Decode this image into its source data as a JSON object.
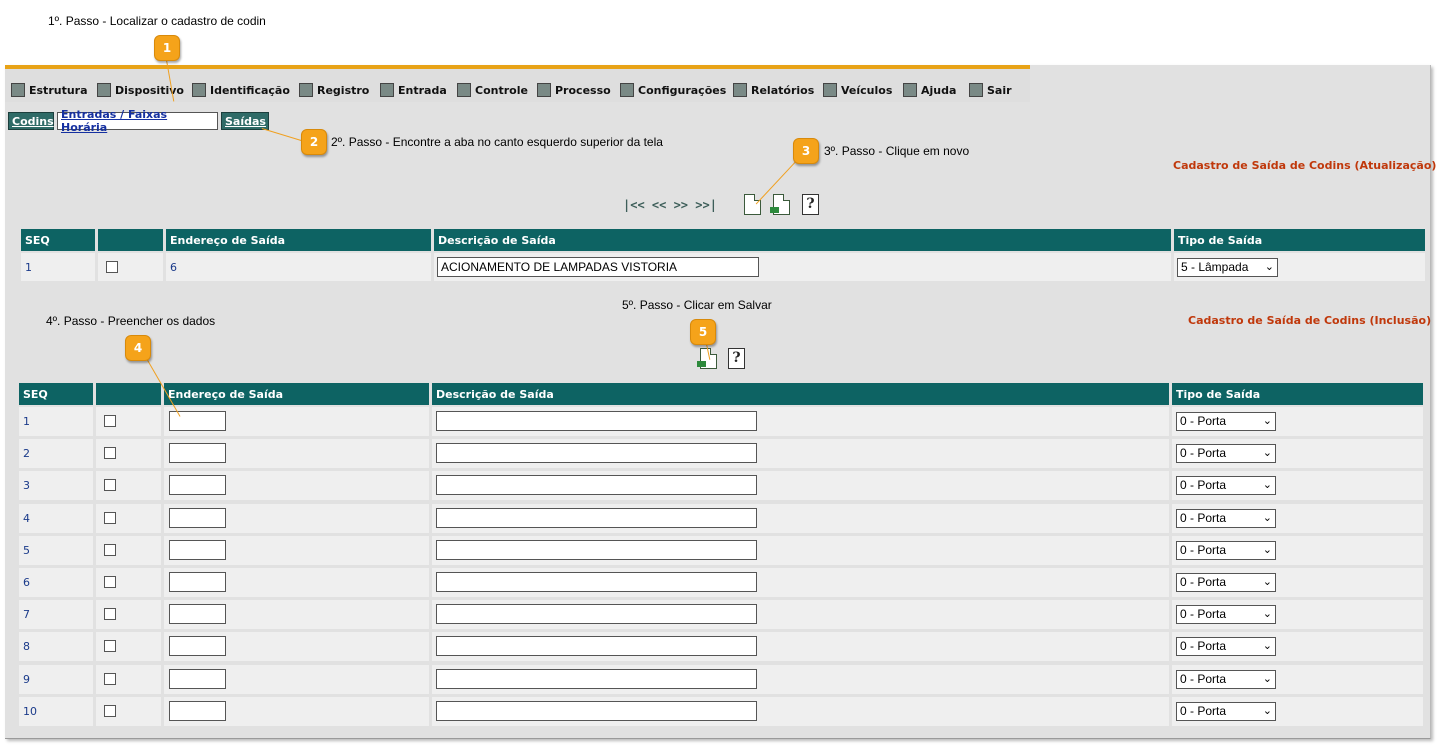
{
  "steps": {
    "s1": "1º. Passo - Localizar o cadastro de codin",
    "s2": "2º. Passo - Encontre a aba no canto esquerdo superior da tela",
    "s3": "3º. Passo - Clique em novo",
    "s4": "4º. Passo - Preencher os dados",
    "s5": "5º. Passo - Clicar em Salvar"
  },
  "badges": [
    "1",
    "2",
    "3",
    "4",
    "5"
  ],
  "menu": [
    {
      "label": "Estrutura",
      "icon": "structure-icon"
    },
    {
      "label": "Dispositivo",
      "icon": "device-icon"
    },
    {
      "label": "Identificação",
      "icon": "id-card-icon"
    },
    {
      "label": "Registro",
      "icon": "register-icon"
    },
    {
      "label": "Entrada",
      "icon": "entry-icon"
    },
    {
      "label": "Controle",
      "icon": "control-icon"
    },
    {
      "label": "Processo",
      "icon": "process-icon"
    },
    {
      "label": "Configurações",
      "icon": "settings-icon"
    },
    {
      "label": "Relatórios",
      "icon": "reports-icon"
    },
    {
      "label": "Veículos",
      "icon": "vehicle-icon"
    },
    {
      "label": "Ajuda",
      "icon": "help-icon"
    },
    {
      "label": "Sair",
      "icon": "exit-icon"
    }
  ],
  "tabs": [
    "Codins",
    "Entradas / Faixas Horária",
    "Saídas"
  ],
  "update_section": {
    "title": "Cadastro de Saída de Codins (Atualização)",
    "nav_icons": "|<< << >> >>|",
    "columns": [
      "SEQ",
      "",
      "Endereço de Saída",
      "Descrição de Saída",
      "Tipo de Saída"
    ],
    "row": {
      "seq": "1",
      "endereco": "6",
      "descricao": "ACIONAMENTO DE LAMPADAS VISTORIA",
      "tipo": "5 - Lâmpada"
    }
  },
  "insert_section": {
    "title": "Cadastro de Saída de Codins (Inclusão)",
    "columns": [
      "SEQ",
      "",
      "Endereço de Saída",
      "Descrição de Saída",
      "Tipo de Saída"
    ],
    "rows": [
      {
        "seq": "1",
        "tipo": "0 - Porta"
      },
      {
        "seq": "2",
        "tipo": "0 - Porta"
      },
      {
        "seq": "3",
        "tipo": "0 - Porta"
      },
      {
        "seq": "4",
        "tipo": "0 - Porta"
      },
      {
        "seq": "5",
        "tipo": "0 - Porta"
      },
      {
        "seq": "6",
        "tipo": "0 - Porta"
      },
      {
        "seq": "7",
        "tipo": "0 - Porta"
      },
      {
        "seq": "8",
        "tipo": "0 - Porta"
      },
      {
        "seq": "9",
        "tipo": "0 - Porta"
      },
      {
        "seq": "10",
        "tipo": "0 - Porta"
      }
    ]
  },
  "colors": {
    "accent": "#e8a317",
    "header": "#0d6363",
    "title": "#c0380b",
    "badge": "#f5a31a"
  }
}
